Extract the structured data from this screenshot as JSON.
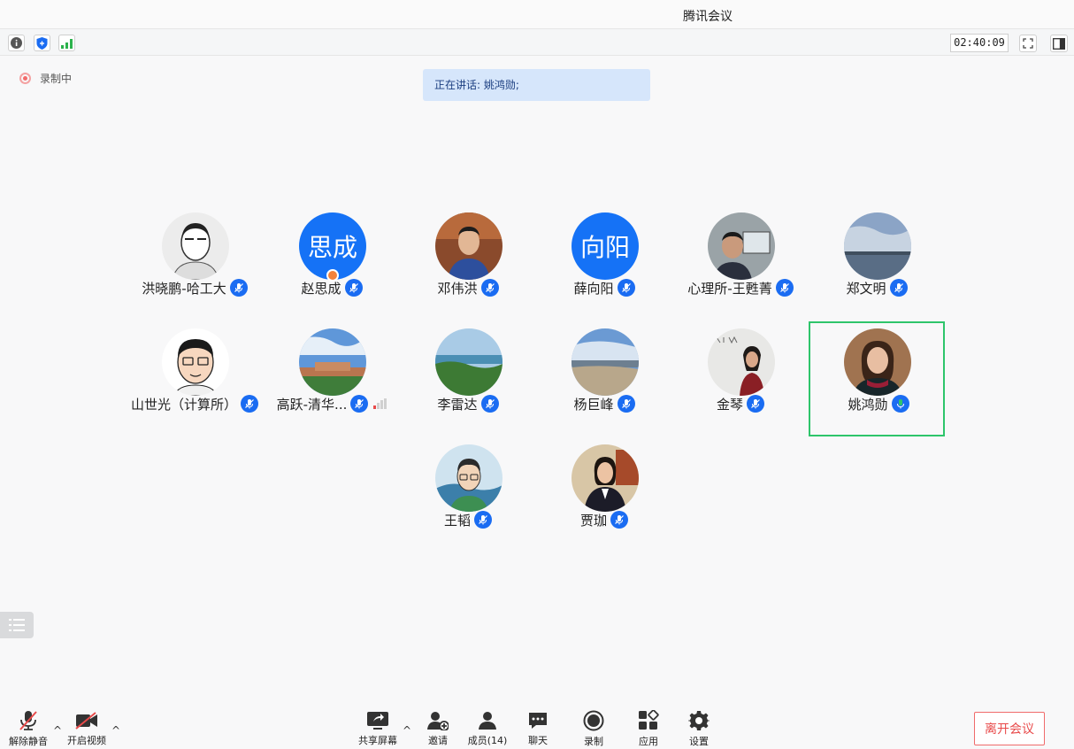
{
  "window": {
    "title": "腾讯会议"
  },
  "toolbar": {
    "info_icon": "info-icon",
    "security_icon": "shield-icon",
    "network_icon": "signal-bars-icon",
    "timer": "02:40:09",
    "fullscreen_icon": "fullscreen-icon",
    "sidebar_icon": "sidebar-toggle-icon"
  },
  "recording": {
    "label": "录制中"
  },
  "speaking": {
    "label": "正在讲话: 姚鸿勋;"
  },
  "participants": [
    {
      "name": "洪晓鹏-哈工大",
      "avatar": "photo"
    },
    {
      "name": "赵思成",
      "avatar_text": "思成",
      "host": true
    },
    {
      "name": "邓伟洪",
      "avatar": "photo"
    },
    {
      "name": "薛向阳",
      "avatar_text": "向阳"
    },
    {
      "name": "心理所-王甦菁",
      "avatar": "photo"
    },
    {
      "name": "郑文明",
      "avatar": "photo"
    },
    {
      "name": "山世光（计算所）",
      "avatar": "photo"
    },
    {
      "name": "高跃-清华...",
      "avatar": "photo"
    },
    {
      "name": "李雷达",
      "avatar": "photo"
    },
    {
      "name": "杨巨峰",
      "avatar": "photo"
    },
    {
      "name": "金琴",
      "avatar": "photo"
    },
    {
      "name": "姚鸿勋",
      "avatar": "photo",
      "speaking": true
    },
    {
      "name": "王韬",
      "avatar": "photo"
    },
    {
      "name": "贾珈",
      "avatar": "photo"
    }
  ],
  "bottom": {
    "unmute": "解除静音",
    "video": "开启视频",
    "share": "共享屏幕",
    "invite": "邀请",
    "members": "成员(14)",
    "chat": "聊天",
    "record": "录制",
    "apps": "应用",
    "settings": "设置",
    "leave": "离开会议"
  },
  "colors": {
    "accent": "#1a6cf2",
    "leave": "#e84a4a",
    "active_speaker": "#2ec56b"
  }
}
